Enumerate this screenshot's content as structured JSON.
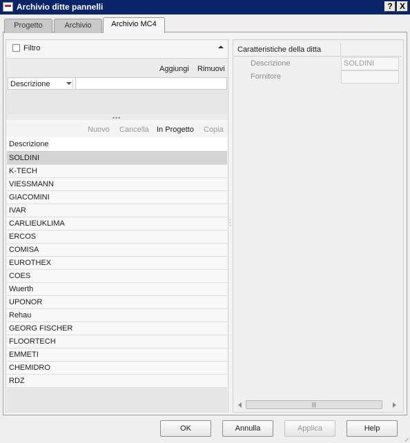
{
  "window": {
    "title": "Archivio ditte pannelli",
    "help_button": "?",
    "close_button": "X"
  },
  "tabs": [
    {
      "label": "Progetto",
      "active": false
    },
    {
      "label": "Archivio",
      "active": false
    },
    {
      "label": "Archivio MC4",
      "active": true
    }
  ],
  "filter": {
    "checkbox_label": "Filtro",
    "checked": false,
    "add_label": "Aggiungi",
    "remove_label": "Rimuovi",
    "field_selected": "Descrizione",
    "value": ""
  },
  "toolbar": {
    "new_label": "Nuovo",
    "delete_label": "Cancella",
    "in_project_label": "In Progetto",
    "copy_label": "Copia"
  },
  "list": {
    "column_header": "Descrizione",
    "selected_index": 0,
    "rows": [
      "SOLDINI",
      "K-TECH",
      "VIESSMANN",
      "GIACOMINI",
      "IVAR",
      "CARLIEUKLIMA",
      "ERCOS",
      "COMISA",
      "EUROTHEX",
      "COES",
      "Wuerth",
      "UPONOR",
      "Rehau",
      "GEORG FISCHER",
      "FLOORTECH",
      "EMMETI",
      "CHEMIDRO",
      "RDZ"
    ]
  },
  "properties": {
    "header": "Caratteristiche della ditta",
    "rows": [
      {
        "label": "Descrizione",
        "value": "SOLDINI"
      },
      {
        "label": "Fornitore",
        "value": ""
      }
    ]
  },
  "buttons": {
    "ok": "OK",
    "cancel": "Annulla",
    "apply": "Applica",
    "help": "Help"
  },
  "colors": {
    "titlebar": "#0a246a",
    "selected_row": "#d4d4d4",
    "disabled_text": "#9a9a9a"
  }
}
